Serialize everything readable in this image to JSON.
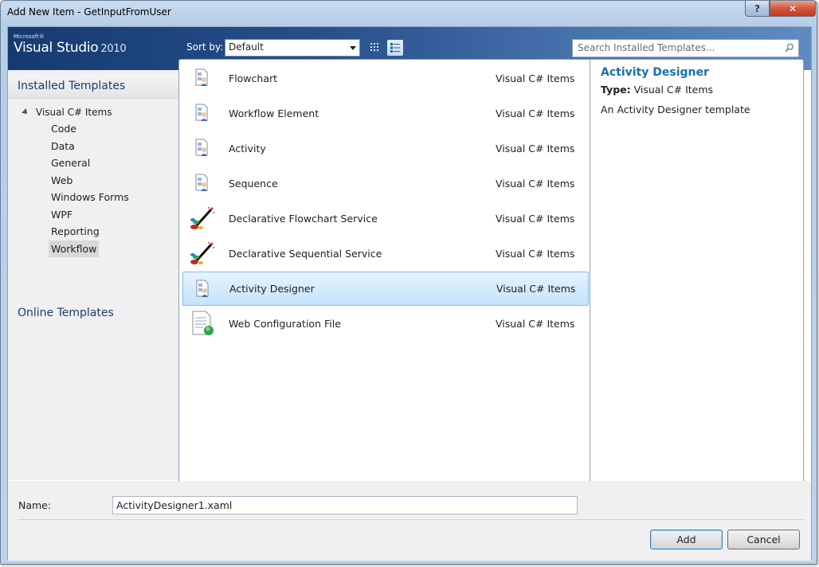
{
  "window": {
    "title": "Add New Item - GetInputFromUser",
    "help_glyph": "?",
    "close_glyph": "✕"
  },
  "brand": {
    "small": "Microsoft®",
    "name": "Visual Studio",
    "version": "2010"
  },
  "toolbar": {
    "sort_label": "Sort by:",
    "sort_value": "Default",
    "search_placeholder": "Search Installed Templates..."
  },
  "sidebar": {
    "installed_label": "Installed Templates",
    "root_label": "Visual C# Items",
    "items": [
      {
        "label": "Code"
      },
      {
        "label": "Data"
      },
      {
        "label": "General"
      },
      {
        "label": "Web"
      },
      {
        "label": "Windows Forms"
      },
      {
        "label": "WPF"
      },
      {
        "label": "Reporting"
      },
      {
        "label": "Workflow",
        "selected": true
      }
    ],
    "online_label": "Online Templates"
  },
  "templates": [
    {
      "name": "Flowchart",
      "lang": "Visual C# Items",
      "icon": "workflow-doc-icon"
    },
    {
      "name": "Workflow Element",
      "lang": "Visual C# Items",
      "icon": "workflow-doc-icon"
    },
    {
      "name": "Activity",
      "lang": "Visual C# Items",
      "icon": "workflow-doc-icon"
    },
    {
      "name": "Sequence",
      "lang": "Visual C# Items",
      "icon": "workflow-doc-icon"
    },
    {
      "name": "Declarative Flowchart Service",
      "lang": "Visual C# Items",
      "icon": "magic-wand-icon"
    },
    {
      "name": "Declarative Sequential Service",
      "lang": "Visual C# Items",
      "icon": "magic-wand-icon"
    },
    {
      "name": "Activity Designer",
      "lang": "Visual C# Items",
      "icon": "workflow-doc-icon",
      "selected": true
    },
    {
      "name": "Web Configuration File",
      "lang": "Visual C# Items",
      "icon": "web-config-icon"
    }
  ],
  "details": {
    "title": "Activity Designer",
    "type_label": "Type:",
    "type_value": "Visual C# Items",
    "description": "An Activity Designer template"
  },
  "footer": {
    "name_label": "Name:",
    "name_value": "ActivityDesigner1.xaml",
    "add_label": "Add",
    "cancel_label": "Cancel"
  }
}
